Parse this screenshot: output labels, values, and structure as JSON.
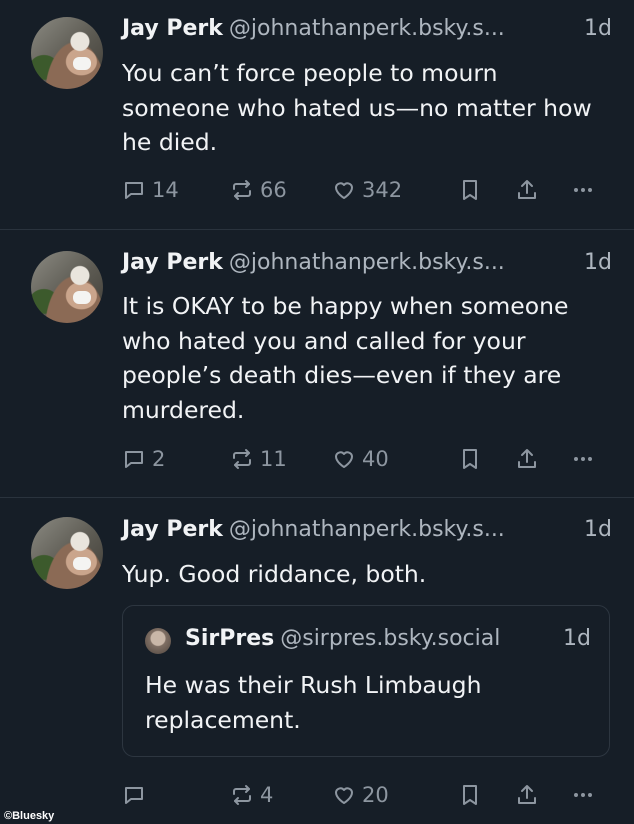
{
  "posts": [
    {
      "author_name": "Jay Perk",
      "handle": "@johnathanperk.bsky.s...",
      "time": "1d",
      "text": "You can’t force people to mourn someone who hated us—no matter how he died.",
      "replies": "14",
      "reposts": "66",
      "likes": "342"
    },
    {
      "author_name": "Jay Perk",
      "handle": "@johnathanperk.bsky.s...",
      "time": "1d",
      "text": "It is OKAY to be happy when someone who hated you and called for your people’s death dies—even if they are murdered.",
      "replies": "2",
      "reposts": "11",
      "likes": "40"
    },
    {
      "author_name": "Jay Perk",
      "handle": "@johnathanperk.bsky.s...",
      "time": "1d",
      "text": "Yup. Good riddance, both.",
      "replies": "",
      "reposts": "4",
      "likes": "20",
      "quote": {
        "author_name": "SirPres",
        "handle": "@sirpres.bsky.social",
        "time": "1d",
        "text": "He was their Rush Limbaugh replacement."
      }
    }
  ],
  "watermark": "©Bluesky",
  "icons": [
    "reply-icon",
    "repost-icon",
    "like-icon",
    "bookmark-icon",
    "share-icon",
    "more-icon"
  ],
  "colors": {
    "background": "#161e27",
    "text": "#f1f3f5",
    "muted": "#aeb6bf",
    "icon": "#8d96a0",
    "divider": "#2a333d"
  }
}
